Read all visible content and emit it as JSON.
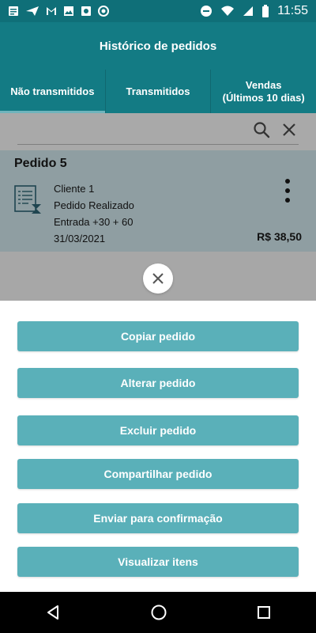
{
  "status_bar": {
    "time": "11:55",
    "icons": [
      "document-icon",
      "navigation-icon",
      "gmail-icon",
      "image-icon",
      "camera-icon",
      "record-icon",
      "dnd-icon",
      "wifi-icon",
      "signal-icon",
      "battery-icon"
    ]
  },
  "appbar": {
    "title": "Histórico de pedidos"
  },
  "tabs": [
    {
      "label": "Não transmitidos",
      "active": true
    },
    {
      "label": "Transmitidos",
      "active": false
    },
    {
      "label": "Vendas",
      "sublabel": "(Últimos 10 dias)",
      "active": false
    }
  ],
  "order": {
    "title": "Pedido 5",
    "client": "Cliente 1",
    "status": "Pedido Realizado",
    "payment": "Entrada +30 + 60",
    "date": "31/03/2021",
    "total": "R$ 38,50"
  },
  "actions": [
    "Copiar pedido",
    "Alterar pedido",
    "Excluir pedido",
    "Compartilhar pedido",
    "Enviar para confirmação",
    "Visualizar itens"
  ],
  "colors": {
    "primary": "#137b84",
    "status_bar": "#0f6f78",
    "action_button": "#5ab0b9",
    "card": "#8f9ea2",
    "overlay": "#a7a7a7"
  }
}
